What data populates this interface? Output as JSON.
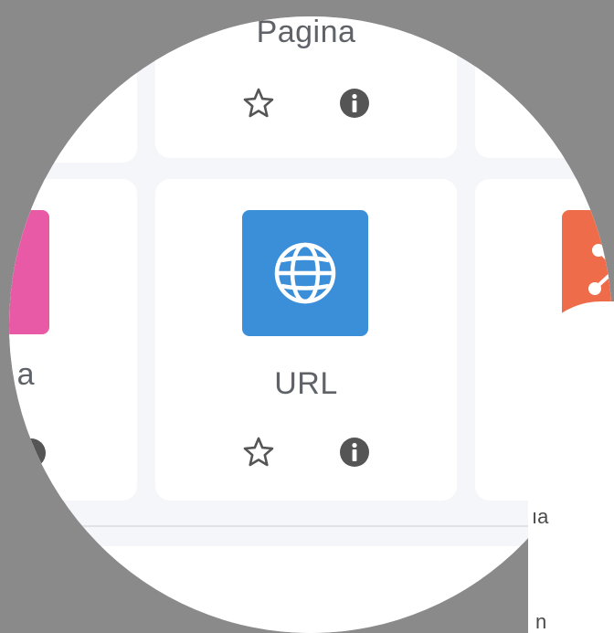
{
  "grid": {
    "top_row": {
      "center_label": "Pagina"
    },
    "middle_row": {
      "left_label_fragment": "a",
      "center_label": "URL",
      "center_icon": "globe-icon",
      "left_tile_color": "#e85aa6",
      "center_tile_color": "#3b8fd9",
      "right_tile_color": "#ef6c4a"
    },
    "actions": {
      "favorite_icon": "star-outline-icon",
      "info_icon": "info-circle-icon"
    }
  },
  "overlay": {
    "line1_fragment": "ıa",
    "line2_fragment": "n"
  }
}
